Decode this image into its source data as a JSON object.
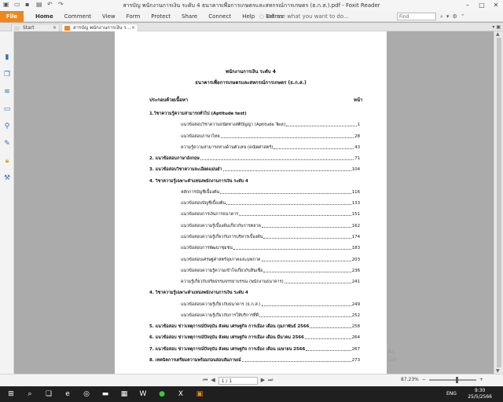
{
  "window": {
    "title": "สารบัญ พนักงานการเงิน ระดับ 4 ธนาคารเพื่อการเกษตรและสหกรณ์การเกษตร (ธ.ก.ส.).pdf - Foxit Reader"
  },
  "ribbon": {
    "file_label": "File",
    "menu": [
      "Home",
      "Comment",
      "View",
      "Form",
      "Protect",
      "Share",
      "Connect",
      "Help",
      "Extras"
    ],
    "tell_me": "Tell me what you want to do...",
    "find_placeholder": "Find"
  },
  "tabs": {
    "start_label": "Start",
    "doc_label": "สารบัญ พนักงานการเงิน ร..."
  },
  "document": {
    "title1": "พนักงานการเงิน ระดับ 4",
    "title2": "ธนาคารเพื่อการเกษตรและสหกรณ์การเกษตร (ธ.ก.ส.)",
    "col_content": "ประกอบด้วยเนื้อหา",
    "col_page": "หน้า",
    "toc": [
      {
        "text": "1.วิชาความรู้ความสามารถทั่วไป (Aptitude test)",
        "page": "",
        "indent": 0,
        "main": true
      },
      {
        "text": "แนวข้อสอบวิชาความถนัดทางสติปัญญา (Aptitude Test)",
        "page": "1",
        "indent": 1,
        "main": false
      },
      {
        "text": "แนวข้อสอบภาษาไทย",
        "page": "28",
        "indent": 1,
        "main": false
      },
      {
        "text": "ความรู้ความสามารถทางด้านตัวเลข (คณิตศาสตร์)",
        "page": "43",
        "indent": 1,
        "main": false
      },
      {
        "text": "2. แนวข้อสอบภาษาอังกฤษ",
        "page": "71",
        "indent": 0,
        "main": true
      },
      {
        "text": "3. แนวข้อสอบวิชาความละเอียดแม่นยำ",
        "page": "104",
        "indent": 0,
        "main": true
      },
      {
        "text": "4. วิชาความรู้เฉพาะตำแหน่งพนักงานการเงิน ระดับ 4",
        "page": "",
        "indent": 0,
        "main": true
      },
      {
        "text": "หลักการบัญชีเบื้องต้น",
        "page": "116",
        "indent": 1,
        "main": false
      },
      {
        "text": "แนวข้อสอบบัญชีเบื้องต้น",
        "page": "133",
        "indent": 1,
        "main": false
      },
      {
        "text": "แนวข้อสอบการเงินการธนาคาร",
        "page": "151",
        "indent": 1,
        "main": false
      },
      {
        "text": "แนวข้อสอบความรู้เบื้องต้นเกี่ยวกับการตลาด",
        "page": "162",
        "indent": 1,
        "main": false
      },
      {
        "text": "แนวข้อสอบความรู้เกี่ยวกับการบริหารเบื้องต้น",
        "page": "174",
        "indent": 1,
        "main": false
      },
      {
        "text": "แนวข้อสอบการพัฒนาชุมชน",
        "page": "183",
        "indent": 1,
        "main": false
      },
      {
        "text": "แนวข้อสอบเศรษฐศาสตร์จุลภาคและมหภาค",
        "page": "203",
        "indent": 1,
        "main": false
      },
      {
        "text": "แนวข้อสอบความรู้ความเข้าใจเกี่ยวกับสินเชื่อ",
        "page": "236",
        "indent": 1,
        "main": false
      },
      {
        "text": "ความรู้เกี่ยวกับจริยธรรมจรรยาบรรณ (พนักงานธนาคาร)",
        "page": "241",
        "indent": 1,
        "main": false
      },
      {
        "text": "4. วิชาความรู้เฉพาะตำแหน่งพนักงานการเงิน ระดับ 4",
        "page": "",
        "indent": 0,
        "main": true
      },
      {
        "text": "แนวข้อสอบความรู้เกี่ยวกับธนาคาร (ธ.ก.ส.)",
        "page": "249",
        "indent": 1,
        "main": false
      },
      {
        "text": "แนวข้อสอบความรู้เกี่ยวกับการให้บริการที่ดี",
        "page": "252",
        "indent": 1,
        "main": false
      },
      {
        "text": "5. แนวข้อสอบ ข่าวเหตุการณ์ปัจจุบัน สังคม เศรษฐกิจ การเมือง เดือน กุมภาพันธ์ 2566",
        "page": "258",
        "indent": 0,
        "main": true
      },
      {
        "text": "6. แนวข้อสอบ ข่าวเหตุการณ์ปัจจุบัน สังคม เศรษฐกิจ การเมือง เดือน มีนาคม 2566",
        "page": "264",
        "indent": 0,
        "main": true
      },
      {
        "text": "7. แนวข้อสอบ ข่าวเหตุการณ์ปัจจุบัน สังคม เศรษฐกิจ การเมือง เดือน เมษายน 2566",
        "page": "267",
        "indent": 0,
        "main": true
      },
      {
        "text": "8. เทคนิคการเตรียมความพร้อมก่อนสอบสัมภาษณ์",
        "page": "273",
        "indent": 0,
        "main": true
      }
    ]
  },
  "watermark": {
    "line1": "Ac",
    "line2": "Go"
  },
  "status": {
    "page_indicator": "1 / 1",
    "zoom": "87.23%"
  },
  "taskbar": {
    "lang": "ENG",
    "time": "9:30",
    "date": "25/5/2566"
  },
  "colors": {
    "accent": "#f0861c",
    "viewer_bg": "#ababab"
  }
}
